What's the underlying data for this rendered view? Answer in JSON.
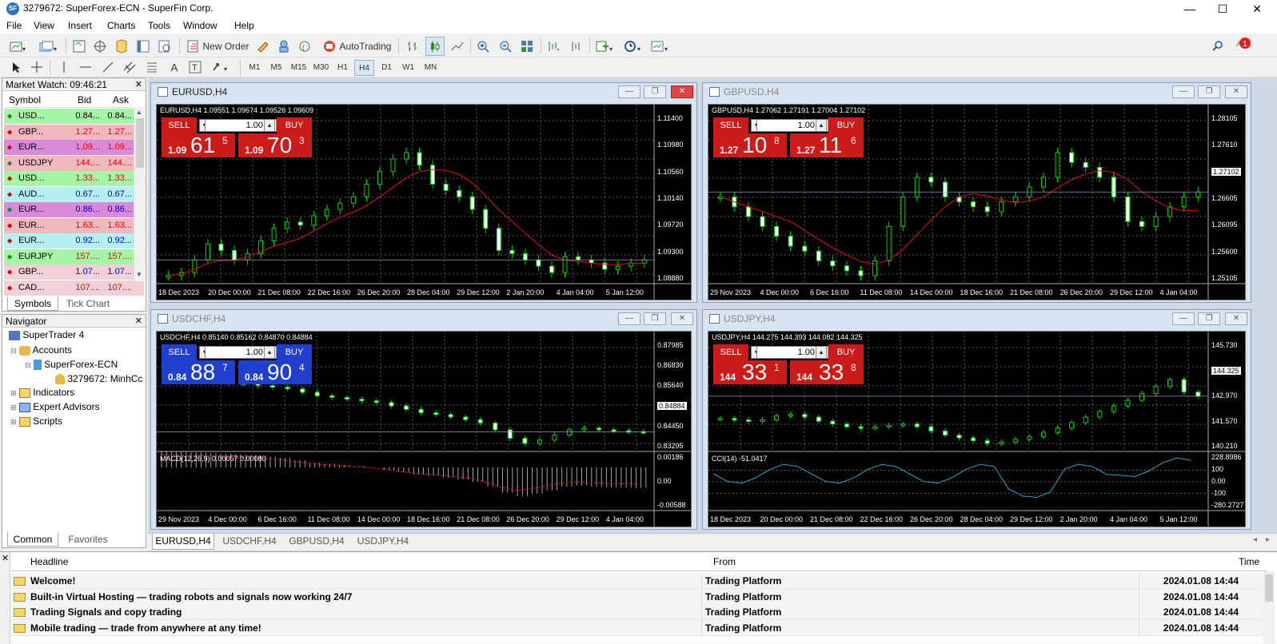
{
  "window": {
    "title": "3279672: SuperForex-ECN - SuperFin Corp.",
    "icon_text": "SF"
  },
  "menu": [
    "File",
    "View",
    "Insert",
    "Charts",
    "Tools",
    "Window",
    "Help"
  ],
  "toolbar": {
    "new_order": "New Order",
    "autotrading": "AutoTrading",
    "notifications": "1"
  },
  "timeframes": [
    "M1",
    "M5",
    "M15",
    "M30",
    "H1",
    "H4",
    "D1",
    "W1",
    "MN"
  ],
  "active_timeframe": "H4",
  "market_watch": {
    "title": "Market Watch: 09:46:21",
    "headers": [
      "Symbol",
      "Bid",
      "Ask"
    ],
    "rows": [
      {
        "symbol": "USD...",
        "bid": "0.84...",
        "ask": "0.84...",
        "color": "#a6f5a6",
        "text": "#000"
      },
      {
        "symbol": "GBP...",
        "bid": "1.27...",
        "ask": "1.27...",
        "color": "#f2b8c0",
        "text": "#e00"
      },
      {
        "symbol": "EUR...",
        "bid": "1.09...",
        "ask": "1.09...",
        "color": "#d98ad9",
        "text": "#e00"
      },
      {
        "symbol": "USDJPY",
        "bid": "144....",
        "ask": "144....",
        "color": "#f2b8c0",
        "text": "#e00"
      },
      {
        "symbol": "USD...",
        "bid": "1.33...",
        "ask": "1.33...",
        "color": "#a6f5a6",
        "text": "#e00"
      },
      {
        "symbol": "AUD...",
        "bid": "0.67...",
        "ask": "0.67...",
        "color": "#b5f0f0",
        "text": "#00c"
      },
      {
        "symbol": "EUR...",
        "bid": "0.86...",
        "ask": "0.86...",
        "color": "#d98ad9",
        "text": "#00c"
      },
      {
        "symbol": "EUR...",
        "bid": "1.63...",
        "ask": "1.63...",
        "color": "#f2b8c0",
        "text": "#e00"
      },
      {
        "symbol": "EUR...",
        "bid": "0.92...",
        "ask": "0.92...",
        "color": "#b5f0f0",
        "text": "#00c"
      },
      {
        "symbol": "EURJPY",
        "bid": "157....",
        "ask": "157....",
        "color": "#a6f5a6",
        "text": "#e00"
      },
      {
        "symbol": "GBP...",
        "bid": "1.07...",
        "ask": "1.07...",
        "color": "#f2d0d8",
        "text": "#00c"
      },
      {
        "symbol": "CAD...",
        "bid": "107....",
        "ask": "107....",
        "color": "#f2d0d8",
        "text": "#e00"
      }
    ],
    "tabs": [
      "Symbols",
      "Tick Chart"
    ]
  },
  "navigator": {
    "title": "Navigator",
    "items": [
      "SuperTrader 4",
      "Accounts",
      "SuperForex-ECN",
      "3279672: MinhCc",
      "Indicators",
      "Expert Advisors",
      "Scripts"
    ],
    "tabs": [
      "Common",
      "Favorites"
    ]
  },
  "charts": [
    {
      "title": "EURUSD,H4",
      "label": "EURUSD,H4  1.09551 1.09674 1.09526 1.09609",
      "sell": "SELL",
      "buy": "BUY",
      "lot": "1.00",
      "sell_small": "1.09",
      "sell_big": "61",
      "sell_sup": "5",
      "buy_small": "1.09",
      "buy_big": "70",
      "buy_sup": "3",
      "panel_color": "#cc1b1b",
      "prices": [
        "1.11400",
        "1.10980",
        "1.10560",
        "1.10140",
        "1.09720",
        "1.09300",
        "1.08880"
      ],
      "current": "1.09609",
      "dates": [
        "18 Dec 2023",
        "20 Dec 00:00",
        "21 Dec 08:00",
        "22 Dec 16:00",
        "26 Dec 20:00",
        "28 Dec 04:00",
        "29 Dec 12:00",
        "2 Jan 20:00",
        "4 Jan 04:00",
        "5 Jan 12:00"
      ],
      "series": [
        1.0935,
        1.094,
        1.096,
        1.0985,
        1.0975,
        1.096,
        1.097,
        1.099,
        1.101,
        1.102,
        1.1015,
        1.103,
        1.104,
        1.105,
        1.106,
        1.108,
        1.11,
        1.112,
        1.113,
        1.111,
        1.108,
        1.107,
        1.106,
        1.104,
        1.101,
        1.0975,
        1.097,
        1.096,
        1.095,
        1.094,
        1.0965,
        1.096,
        1.0955,
        1.0945,
        1.095,
        1.0955,
        1.096
      ]
    },
    {
      "title": "GBPUSD,H4",
      "label": "GBPUSD,H4  1.27062 1.27191 1.27004 1.27102",
      "sell": "SELL",
      "buy": "BUY",
      "lot": "1.00",
      "sell_small": "1.27",
      "sell_big": "10",
      "sell_sup": "8",
      "buy_small": "1.27",
      "buy_big": "11",
      "buy_sup": "6",
      "panel_color": "#cc1b1b",
      "prices": [
        "1.28105",
        "1.27610",
        "1.27102",
        "1.26605",
        "1.26095",
        "1.25600",
        "1.25105"
      ],
      "current": "1.27102",
      "dates": [
        "29 Nov 2023",
        "4 Dec 00:00",
        "6 Dec 16:00",
        "11 Dec 08:00",
        "14 Dec 00:00",
        "18 Dec 16:00",
        "21 Dec 08:00",
        "26 Dec 20:00",
        "29 Dec 12:00",
        "4 Jan 04:00"
      ],
      "series": [
        1.27,
        1.268,
        1.266,
        1.264,
        1.262,
        1.26,
        1.259,
        1.257,
        1.256,
        1.255,
        1.254,
        1.257,
        1.264,
        1.27,
        1.274,
        1.273,
        1.27,
        1.269,
        1.268,
        1.267,
        1.269,
        1.27,
        1.272,
        1.274,
        1.279,
        1.277,
        1.276,
        1.274,
        1.27,
        1.265,
        1.264,
        1.266,
        1.268,
        1.27,
        1.271
      ]
    },
    {
      "title": "USDCHF,H4",
      "label": "USDCHF,H4  0.85140 0.85162 0.84870 0.84884",
      "sell": "SELL",
      "buy": "BUY",
      "lot": "1.00",
      "sell_small": "0.84",
      "sell_big": "88",
      "sell_sup": "7",
      "buy_small": "0.84",
      "buy_big": "90",
      "buy_sup": "4",
      "panel_color": "#1f3fcc",
      "prices": [
        "0.87985",
        "0.86830",
        "0.85640",
        "0.84884",
        "0.84450",
        "0.83295"
      ],
      "current": "0.84884",
      "macd_label": "MACD(12,26,9) 0.00057 0.00080",
      "macd_prices": [
        "0.00186",
        "0.00",
        "-0.00588"
      ],
      "dates": [
        "29 Nov 2023",
        "4 Dec 00:00",
        "6 Dec 16:00",
        "11 Dec 08:00",
        "14 Dec 00:00",
        "18 Dec 16:00",
        "21 Dec 08:00",
        "26 Dec 20:00",
        "29 Dec 12:00",
        "4 Jan 04:00"
      ],
      "series": [
        0.8795,
        0.879,
        0.8785,
        0.878,
        0.8775,
        0.877,
        0.876,
        0.875,
        0.874,
        0.872,
        0.87,
        0.869,
        0.868,
        0.867,
        0.866,
        0.864,
        0.862,
        0.86,
        0.859,
        0.8575,
        0.856,
        0.854,
        0.85,
        0.845,
        0.842,
        0.844,
        0.847,
        0.85,
        0.851,
        0.85,
        0.8495,
        0.849,
        0.8488
      ]
    },
    {
      "title": "USDJPY,H4",
      "label": "USDJPY,H4  144.275 144.393 144.082 144.325",
      "sell": "SELL",
      "buy": "BUY",
      "lot": "1.00",
      "sell_small": "144",
      "sell_big": "33",
      "sell_sup": "1",
      "buy_small": "144",
      "buy_big": "33",
      "buy_sup": "8",
      "panel_color": "#cc1b1b",
      "prices": [
        "145.730",
        "144.325",
        "142.970",
        "141.570",
        "140.210"
      ],
      "current": "144.325",
      "cci_label": "CCI(14) -51.0417",
      "cci_prices": [
        "228.8986",
        "100",
        "0.00",
        "-100",
        "-280.2727"
      ],
      "dates": [
        "18 Dec 2023",
        "20 Dec 00:00",
        "21 Dec 08:00",
        "22 Dec 16:00",
        "26 Dec 20:00",
        "28 Dec 04:00",
        "29 Dec 12:00",
        "2 Jan 20:00",
        "4 Jan 04:00",
        "5 Jan 12:00"
      ],
      "series": [
        142.7,
        142.6,
        142.5,
        142.6,
        142.9,
        143.0,
        142.8,
        142.5,
        142.3,
        142.1,
        142.0,
        142.1,
        142.2,
        142.3,
        142.1,
        141.8,
        141.5,
        141.3,
        141.1,
        140.9,
        141.0,
        141.2,
        141.4,
        141.7,
        142.0,
        142.4,
        142.8,
        143.2,
        143.6,
        144.0,
        144.5,
        145.0,
        145.5,
        144.6,
        144.3
      ]
    }
  ],
  "chart_tabs": [
    "EURUSD,H4",
    "USDCHF,H4",
    "GBPUSD,H4",
    "USDJPY,H4"
  ],
  "news": {
    "headers": [
      "Headline",
      "From",
      "Time"
    ],
    "rows": [
      {
        "headline": "Welcome!",
        "from": "Trading Platform",
        "time": "2024.01.08 14:44"
      },
      {
        "headline": "Built-in Virtual Hosting — trading robots and signals now working 24/7",
        "from": "Trading Platform",
        "time": "2024.01.08 14:44"
      },
      {
        "headline": "Trading Signals and copy trading",
        "from": "Trading Platform",
        "time": "2024.01.08 14:44"
      },
      {
        "headline": "Mobile trading — trade from anywhere at any time!",
        "from": "Trading Platform",
        "time": "2024.01.08 14:44"
      }
    ]
  }
}
